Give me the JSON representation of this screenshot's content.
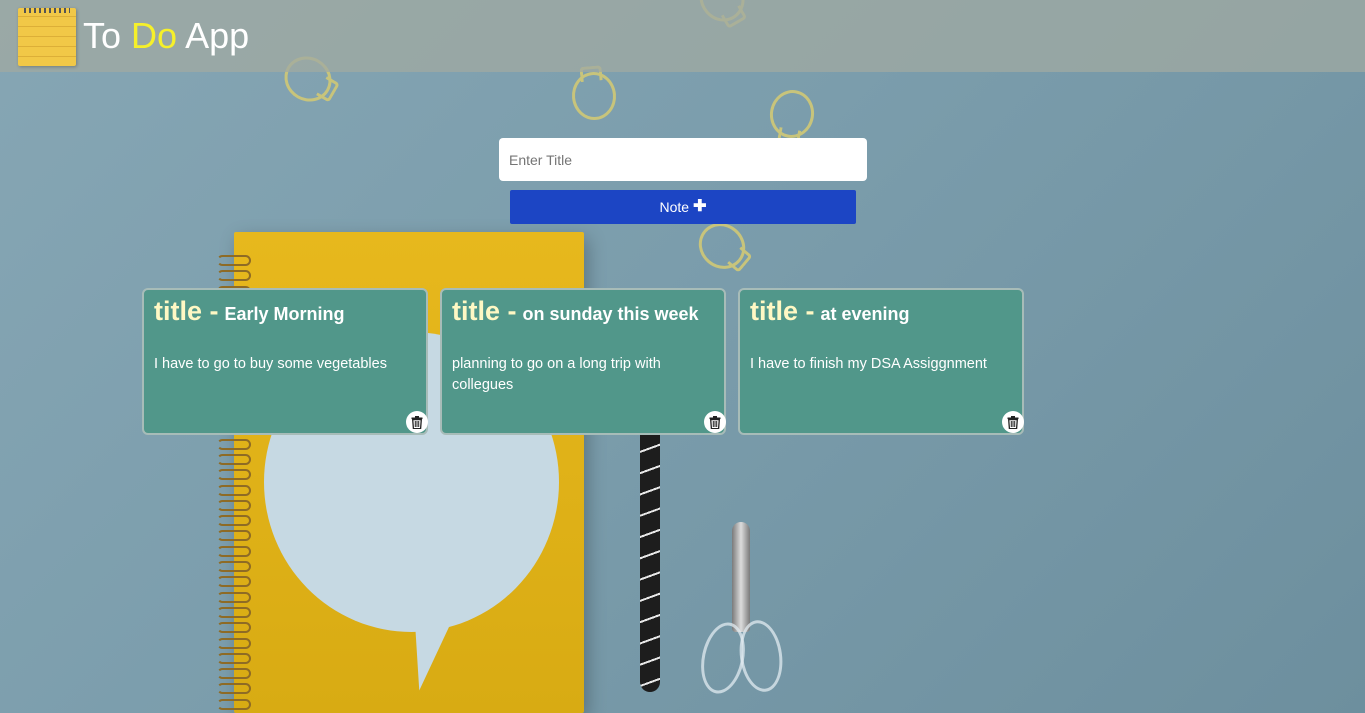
{
  "header": {
    "logo_icon": "notepad-icon",
    "title_part1": "To ",
    "title_accent": "Do",
    "title_part2": " App",
    "accent_color": "#f6f02a"
  },
  "form": {
    "title_placeholder": "Enter Title",
    "title_value": "",
    "add_button_label": "Note",
    "add_button_icon": "plus-icon",
    "add_button_color": "#1c45c4"
  },
  "notes": [
    {
      "prefix": "title -",
      "title": "Early Morning",
      "body": "I have to go to buy some vegetables",
      "delete_icon": "trash-icon"
    },
    {
      "prefix": "title -",
      "title": "on sunday this week",
      "body": "planning to go on a long trip with collegues",
      "delete_icon": "trash-icon"
    },
    {
      "prefix": "title -",
      "title": "at evening",
      "body": "I have to finish my DSA Assiggnment",
      "delete_icon": "trash-icon"
    }
  ],
  "colors": {
    "card_background": "#51978a",
    "card_prefix": "#fff8c4"
  }
}
